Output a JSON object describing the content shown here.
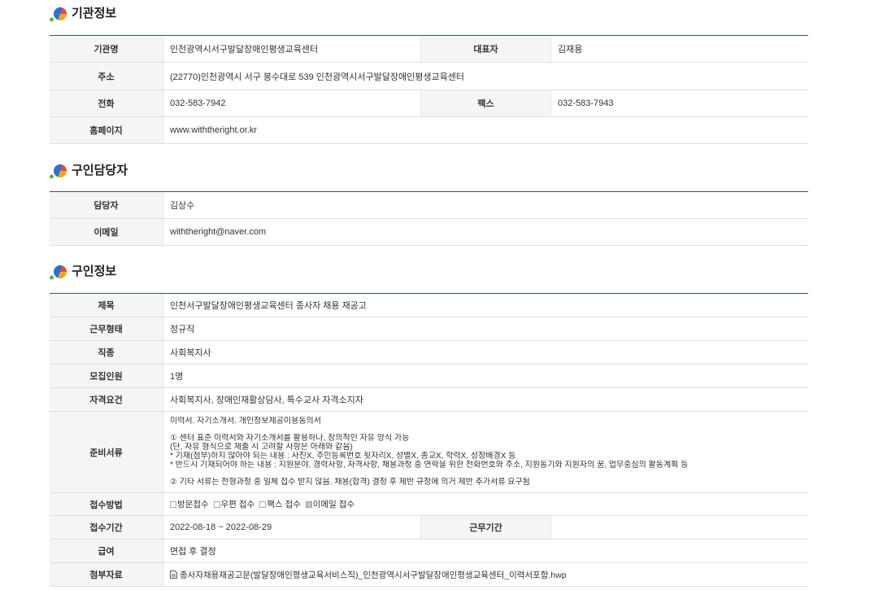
{
  "org_info": {
    "title": "기관정보",
    "name": {
      "label": "기관명",
      "value": "인천광역시서구발달장애인평생교육센터"
    },
    "ceo": {
      "label": "대표자",
      "value": "김재용"
    },
    "address": {
      "label": "주소",
      "value": "(22770)인천광역시 서구 봉수대로 539 인천광역시서구발달장애인평생교육센터"
    },
    "phone": {
      "label": "전화",
      "value": "032-583-7942"
    },
    "fax": {
      "label": "팩스",
      "value": "032-583-7943"
    },
    "homepage": {
      "label": "홈페이지",
      "value": "www.withtheright.or.kr"
    }
  },
  "contact": {
    "title": "구인담당자",
    "manager": {
      "label": "담당자",
      "value": "김상수"
    },
    "email": {
      "label": "이메일",
      "value": "withtheright@naver.com"
    }
  },
  "job_info": {
    "title": "구인정보",
    "subject": {
      "label": "제목",
      "value": "인천서구발달장애인평생교육센터 종사자 채용 재공고"
    },
    "employment_type": {
      "label": "근무형태",
      "value": "정규직"
    },
    "occupation": {
      "label": "직종",
      "value": "사회복지사"
    },
    "headcount": {
      "label": "모집인원",
      "value": "1명"
    },
    "qualifications": {
      "label": "자격요건",
      "value": "사회복지사, 장애인재활상담사, 특수교사 자격소지자"
    },
    "documents": {
      "label": "준비서류",
      "lines": [
        "이력서. 자기소개서. 개인정보제공이용동의서",
        "① 센터 표준 이력서와 자기소개서를 활용하나, 창의적인 자유 양식 가능",
        "(단, 자유 형식으로 제출 시 고려할 사항은 아래와 같음)",
        "* 기재(첨부)하지 않아야 되는 내용 : 사진X, 주민등록번호 뒷자리X, 성별X, 종교X, 학력X, 성장배경X 등",
        "* 반드시 기재되어야 하는 내용 : 지원분야, 경력사항, 자격사항, 채용과정 중 연락을 위한 전화번호와 주소, 지원동기와 지원자의 꿈, 업무중심의 활동계획 등",
        "② 기타 서류는 전형과정 중 일체 접수 받지 않음. 채용(합격) 결정 후 제반 규정에 의거 제반 추가서류 요구됨"
      ]
    },
    "application_method": {
      "label": "접수방법",
      "options": [
        {
          "label": "방문접수",
          "checked": false
        },
        {
          "label": "우편 접수",
          "checked": false
        },
        {
          "label": "팩스 접수",
          "checked": false
        },
        {
          "label": "이메일 접수",
          "checked": true
        }
      ]
    },
    "application_period": {
      "label": "접수기간",
      "value": "2022-08-18 ~ 2022-08-29"
    },
    "work_period": {
      "label": "근무기간",
      "value": ""
    },
    "salary": {
      "label": "급여",
      "value": "면접 후 결정"
    },
    "attachment": {
      "label": "첨부자료",
      "file_name": "종사자채용재공고문(발달장애인평생교육서비스직)_인천광역시서구발달장애인평생교육센터_이력서포함.hwp"
    }
  },
  "icons": {
    "section_bullet": "section-bullet-icon",
    "attachment": "file-icon"
  },
  "colors": {
    "section_rule": "#2f5763",
    "label_background": "#f5f5f5",
    "row_border": "#dedede",
    "icon_blue": "#2f6fd0",
    "icon_orange": "#f6a81c",
    "icon_red": "#e64b3c",
    "icon_green": "#5bb53a"
  }
}
